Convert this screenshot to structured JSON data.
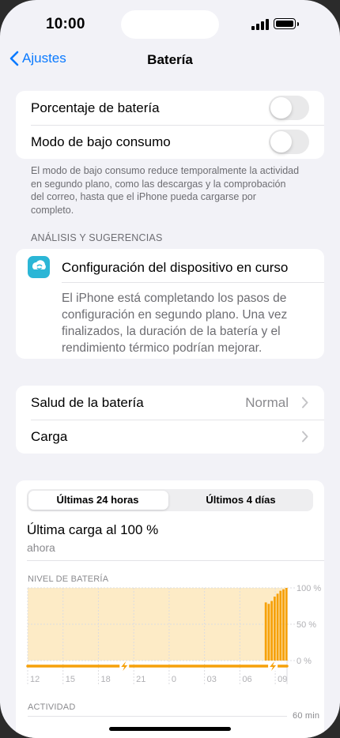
{
  "status_bar": {
    "time": "10:00"
  },
  "nav": {
    "back_label": "Ajustes",
    "title": "Batería"
  },
  "toggles": {
    "battery_percentage": {
      "label": "Porcentaje de batería",
      "on": false
    },
    "low_power_mode": {
      "label": "Modo de bajo consumo",
      "on": false
    }
  },
  "low_power_footnote": "El modo de bajo consumo reduce temporalmente la actividad en segundo plano, como las descargas y la comprobación del correo, hasta que el iPhone pueda cargarse por completo.",
  "insights": {
    "header": "ANÁLISIS Y SUGERENCIAS",
    "title": "Configuración del dispositivo en curso",
    "body": "El iPhone está completando los pasos de configuración en segundo plano. Una vez finalizados, la duración de la batería y el rendimiento térmico podrían mejorar."
  },
  "health": {
    "battery_health_label": "Salud de la batería",
    "battery_health_value": "Normal",
    "charging_label": "Carga"
  },
  "usage": {
    "tabs": [
      "Últimas 24 horas",
      "Últimos 4 días"
    ],
    "selected_tab": 0,
    "last_charge_title": "Última carga al 100 %",
    "last_charge_time": "ahora",
    "battery_level_header": "NIVEL DE BATERÍA",
    "activity_header": "ACTIVIDAD",
    "activity_axis_top": "60 min"
  },
  "colors": {
    "accent": "#0a7aff",
    "battery_bar": "#f6a10a",
    "charging_bg": "#fdebc6"
  },
  "chart_data": {
    "type": "bar",
    "title": "NIVEL DE BATERÍA",
    "x_ticks": [
      "12",
      "15",
      "18",
      "21",
      "0",
      "03",
      "06",
      "09"
    ],
    "y_ticks": [
      "100 %",
      "50 %",
      "0 %"
    ],
    "ylim": [
      0,
      100
    ],
    "x_range_hours": [
      12,
      34
    ],
    "series": [
      {
        "values_hours": [
          32.2,
          32.45,
          32.7,
          32.95,
          33.2,
          33.45,
          33.7,
          33.95
        ],
        "values": [
          80,
          78,
          82,
          88,
          92,
          96,
          98,
          100
        ]
      }
    ],
    "charging_periods_hours": [
      [
        12,
        34
      ]
    ],
    "grid": true
  }
}
